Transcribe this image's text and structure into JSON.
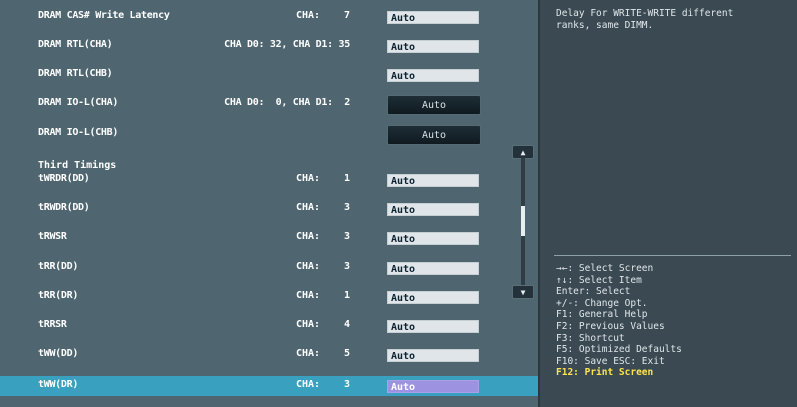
{
  "help": {
    "line1": "Delay For WRITE-WRITE different",
    "line2": "ranks, same DIMM."
  },
  "section_title": "Third Timings",
  "rows": [
    {
      "label": "DRAM CAS# Write Latency",
      "channel": "CHA:",
      "value": "7",
      "field": "Auto"
    },
    {
      "label": "DRAM RTL(CHA)",
      "info": "CHA D0: 32, CHA D1: 35",
      "field": "Auto"
    },
    {
      "label": "DRAM RTL(CHB)",
      "field": "Auto"
    },
    {
      "label": "DRAM IO-L(CHA)",
      "info": "CHA D0:  0, CHA D1:  2",
      "button": "Auto"
    },
    {
      "label": "DRAM IO-L(CHB)",
      "button": "Auto"
    },
    {
      "label": "tWRDR(DD)",
      "channel": "CHA:",
      "value": "1",
      "field": "Auto"
    },
    {
      "label": "tRWDR(DD)",
      "channel": "CHA:",
      "value": "3",
      "field": "Auto"
    },
    {
      "label": "tRWSR",
      "channel": "CHA:",
      "value": "3",
      "field": "Auto"
    },
    {
      "label": "tRR(DD)",
      "channel": "CHA:",
      "value": "3",
      "field": "Auto"
    },
    {
      "label": "tRR(DR)",
      "channel": "CHA:",
      "value": "1",
      "field": "Auto"
    },
    {
      "label": "tRRSR",
      "channel": "CHA:",
      "value": "4",
      "field": "Auto"
    },
    {
      "label": "tWW(DD)",
      "channel": "CHA:",
      "value": "5",
      "field": "Auto"
    },
    {
      "label": "tWW(DR)",
      "channel": "CHA:",
      "value": "3",
      "field": "Auto"
    }
  ],
  "keys": [
    "→←: Select Screen",
    "↑↓: Select Item",
    "Enter: Select",
    "+/-: Change Opt.",
    "F1: General Help",
    "F2: Previous Values",
    "F3: Shortcut",
    "F5: Optimized Defaults",
    "F10: Save  ESC: Exit",
    "F12: Print Screen"
  ],
  "scroll": {
    "up": "▲",
    "down": "▼"
  },
  "colors": {
    "selected_row": "#3aa0bf",
    "selected_field": "#9d92e0",
    "highlight_key": "#ffe34a"
  }
}
